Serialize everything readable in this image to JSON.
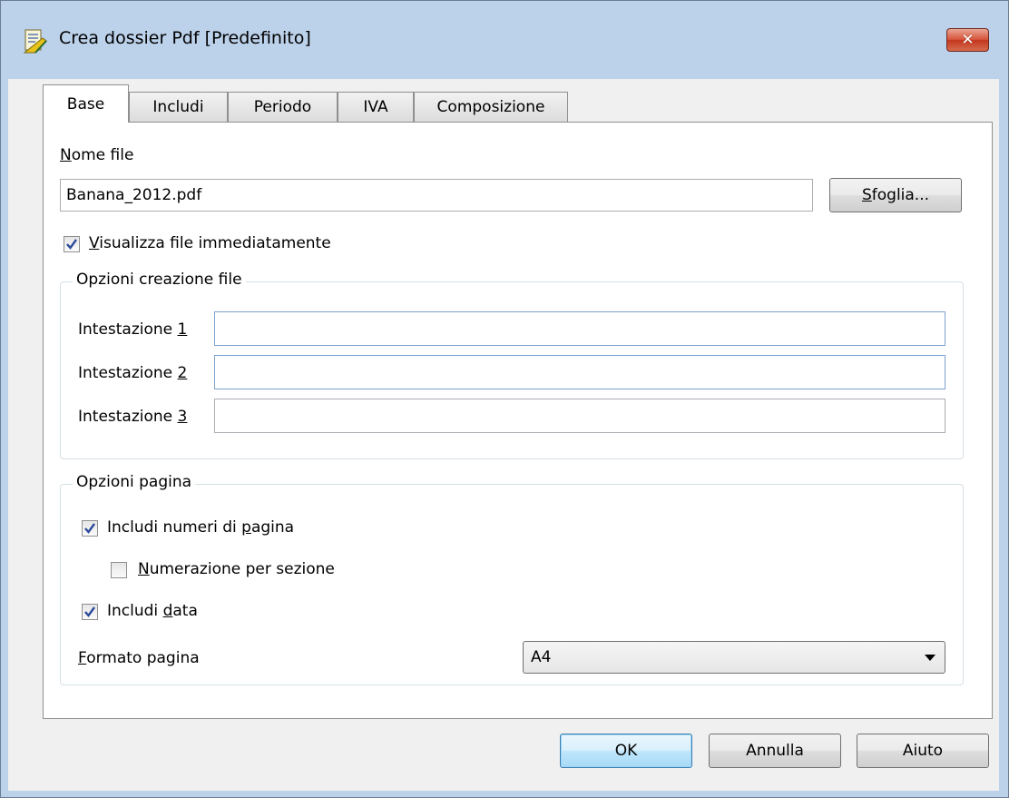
{
  "window": {
    "title": "Crea dossier Pdf [Predefinito]",
    "close_label": "✕"
  },
  "tabs": [
    {
      "label": "Base",
      "active": true
    },
    {
      "label": "Includi",
      "active": false
    },
    {
      "label": "Periodo",
      "active": false
    },
    {
      "label": "IVA",
      "active": false
    },
    {
      "label": "Composizione",
      "active": false
    }
  ],
  "base": {
    "file_name_label_mnemonic": "N",
    "file_name_label_rest": "ome file",
    "file_name_value": "Banana_2012.pdf",
    "browse_mnemonic": "S",
    "browse_rest": "foglia...",
    "show_file_mnemonic": "V",
    "show_file_rest": "isualizza file immediatamente",
    "show_file_checked": true,
    "file_options": {
      "title": "Opzioni creazione file",
      "headers": [
        {
          "label": "Intestazione ",
          "mnemonic": "1",
          "value": ""
        },
        {
          "label": "Intestazione ",
          "mnemonic": "2",
          "value": ""
        },
        {
          "label": "Intestazione ",
          "mnemonic": "3",
          "value": ""
        }
      ]
    },
    "page_options": {
      "title": "Opzioni pagina",
      "page_numbers_pre": "Includi numeri di ",
      "page_numbers_mnemonic": "p",
      "page_numbers_post": "agina",
      "page_numbers_checked": true,
      "section_numbering_mnemonic": "N",
      "section_numbering_rest": "umerazione per sezione",
      "section_numbering_checked": false,
      "include_date_pre": "Includi ",
      "include_date_mnemonic": "d",
      "include_date_post": "ata",
      "include_date_checked": true,
      "page_format_mnemonic": "F",
      "page_format_rest": "ormato pagina",
      "page_format_value": "A4"
    }
  },
  "footer": {
    "ok": "OK",
    "cancel": "Annulla",
    "help": "Aiuto"
  }
}
